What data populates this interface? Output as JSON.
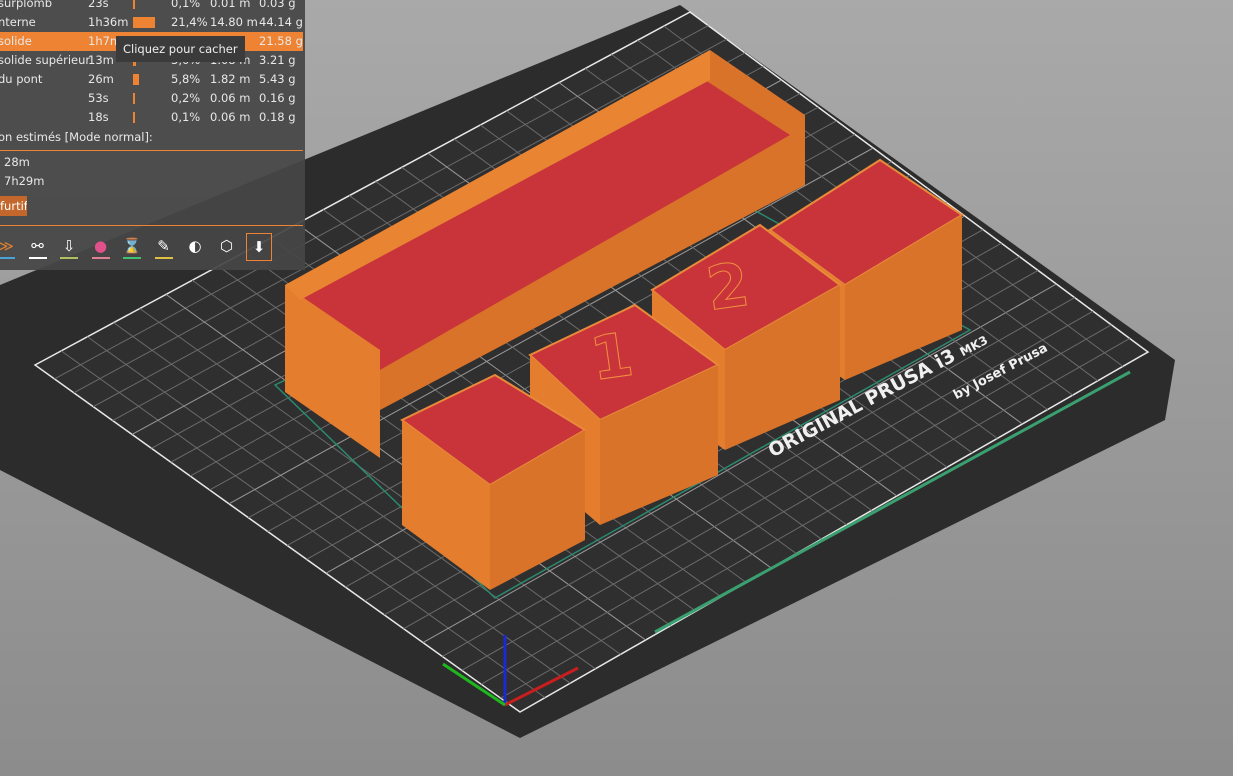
{
  "legend_table": {
    "rows": [
      {
        "name": "surplomb",
        "time": "23s",
        "percent": "0,1%",
        "length": "0.01 m",
        "weight": "0.03 g",
        "bar": 0.01
      },
      {
        "name": "nterne",
        "time": "1h36m",
        "percent": "21,4%",
        "length": "14.80 m",
        "weight": "44.14 g",
        "bar": 1.0
      },
      {
        "name": "solide",
        "time": "1h7m",
        "percent": "",
        "length": "m",
        "weight": "21.58 g",
        "bar": 0.7,
        "selected": true
      },
      {
        "name": "solide supérieur",
        "time": "13m",
        "percent": "3,0%",
        "length": "1.08 m",
        "weight": "3.21 g",
        "bar": 0.14
      },
      {
        "name": "du pont",
        "time": "26m",
        "percent": "5,8%",
        "length": "1.82 m",
        "weight": "5.43 g",
        "bar": 0.27
      },
      {
        "name": "",
        "time": "53s",
        "percent": "0,2%",
        "length": "0.06 m",
        "weight": "0.16 g",
        "bar": 0.01
      },
      {
        "name": "",
        "time": "18s",
        "percent": "0,1%",
        "length": "0.06 m",
        "weight": "0.18 g",
        "bar": 0.01
      }
    ]
  },
  "tooltip": "Cliquez pour cacher",
  "estimates": {
    "heading": "on estimés [Mode normal]:",
    "first_layer": "28m",
    "total": "7h29m",
    "stealth_button": "furtif"
  },
  "toolbar": [
    {
      "icon": "travel-icon",
      "glyph": "≫",
      "color": "#4aa3d8"
    },
    {
      "icon": "wipe-icon",
      "glyph": "⚯",
      "color": "#ffffff"
    },
    {
      "icon": "retraction-icon",
      "glyph": "⇩",
      "color": "#b0c060"
    },
    {
      "icon": "color-change-icon",
      "glyph": "●",
      "color": "#e08090"
    },
    {
      "icon": "pause-icon",
      "glyph": "⌛",
      "color": "#40c070"
    },
    {
      "icon": "custom-gcode-icon",
      "glyph": "✎",
      "color": "#e0c040"
    },
    {
      "icon": "center-of-gravity-icon",
      "glyph": "◐",
      "color": ""
    },
    {
      "icon": "shells-icon",
      "glyph": "⬡",
      "color": ""
    },
    {
      "icon": "tool-marker-icon",
      "glyph": "⬇",
      "color": ""
    }
  ],
  "bed": {
    "brand": "ORIGINAL PRUSA i3",
    "model": "MK3",
    "by": "by Josef Prusa"
  },
  "colors": {
    "accent": "#ee8433",
    "model_wall": "#e0792a",
    "infill": "#c9343a",
    "bed": "#2b2b2b"
  }
}
